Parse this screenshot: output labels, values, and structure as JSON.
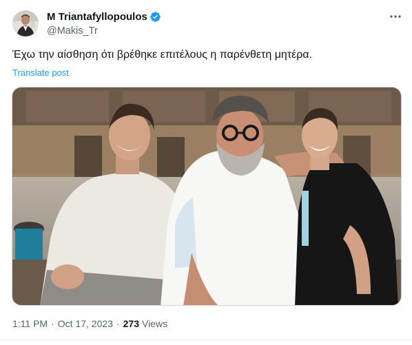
{
  "author": {
    "display_name": "M Triantafyllopoulos",
    "handle": "@Makis_Tr",
    "verified": true,
    "verified_color": "#1d9bf0"
  },
  "tweet": {
    "text": "Έχω την αίσθηση ότι βρέθηκε επιτέλους η παρένθετη μητέρα.",
    "translate_label": "Translate post"
  },
  "media": {
    "type": "photo",
    "icon": "photo-image"
  },
  "meta": {
    "time": "1:11 PM",
    "separator": "·",
    "date": "Oct 17, 2023",
    "views_count": "273",
    "views_label": "Views"
  },
  "icons": {
    "more": "more-dots-icon",
    "verified": "verified-badge-icon"
  },
  "colors": {
    "link": "#1d9bf0",
    "secondary_text": "#536471",
    "primary_text": "#0f1419"
  }
}
